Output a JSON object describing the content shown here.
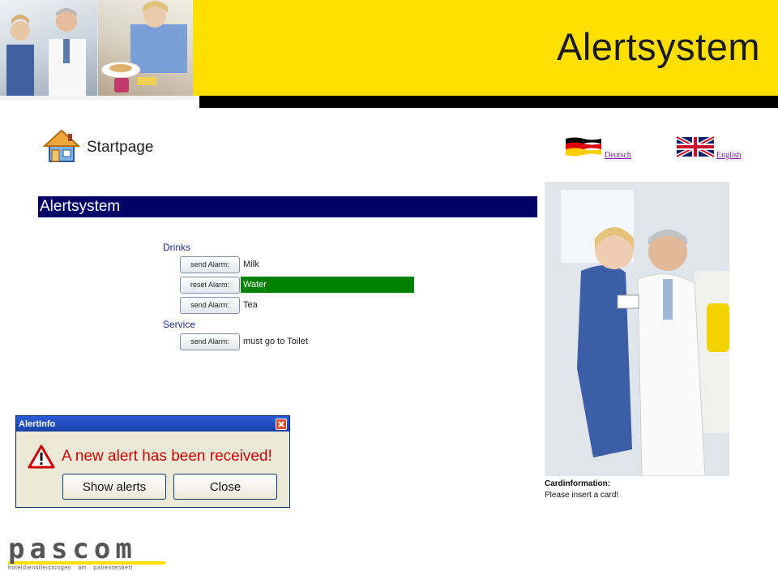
{
  "header": {
    "title": "Alertsystem"
  },
  "nav": {
    "startpage_label": "Startpage"
  },
  "languages": [
    {
      "label": "Deutsch",
      "flag": "de-flag"
    },
    {
      "label": "English",
      "flag": "uk-flag"
    }
  ],
  "section": {
    "title": "Alertsystem"
  },
  "groups": [
    {
      "label": "Drinks",
      "items": [
        {
          "button": "send Alarm:",
          "label": "Milk",
          "active": false
        },
        {
          "button": "reset Alarm:",
          "label": "Water",
          "active": true
        },
        {
          "button": "send Alarm:",
          "label": "Tea",
          "active": false
        }
      ]
    },
    {
      "label": "Service",
      "items": [
        {
          "button": "send Alarm:",
          "label": "must go to Toilet",
          "active": false
        }
      ]
    }
  ],
  "card": {
    "title": "Cardinformation:",
    "text": "Please insert a card!"
  },
  "dialog": {
    "title": "AlertInfo",
    "message": "A new alert has been received!",
    "show_button": "Show alerts",
    "close_button": "Close"
  },
  "logo": {
    "word": "pascom",
    "sub": "hoteldienstleistungen · am · patientenbett"
  },
  "colors": {
    "header_yellow": "#fedf00",
    "section_bar": "#000066",
    "active_row": "#008000",
    "alert_text": "#cc0000"
  }
}
